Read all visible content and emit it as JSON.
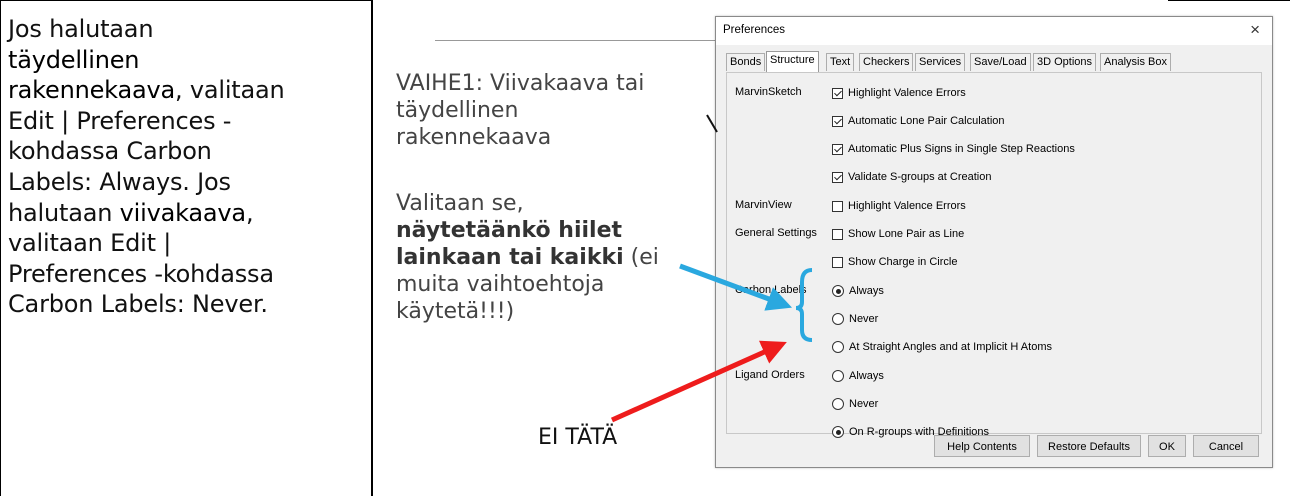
{
  "left_text": {
    "l1": "Jos halutaan",
    "l2": "täydellinen",
    "l3a": "rakennekaava",
    "l3b": ", valitaan",
    "l4": "Edit | Preferences -",
    "l5": "kohdassa Carbon",
    "l6": "Labels:  Always. Jos",
    "l7a": "halutaan ",
    "l7b": "viivakaava",
    "l7c": ",",
    "l8": "valitaan Edit |",
    "l9": "Preferences -kohdassa",
    "l10": "Carbon Labels: Never."
  },
  "middle": {
    "step_l1": "VAIHE1: Viivakaava tai",
    "step_l2": "täydellinen",
    "step_l3": "rakennekaava",
    "choose_l1": "Valitaan se,",
    "choose_b1": "näytetäänkö hiilet",
    "choose_b2": "lainkaan tai kaikki",
    "choose_l3b": " (ei",
    "choose_l4": "muita vaihtoehtoja",
    "choose_l5": "käytetä!!!)",
    "not_this": "EI TÄTÄ"
  },
  "dialog": {
    "title": "Preferences",
    "close": "×",
    "tabs": [
      "Bonds",
      "Structure",
      "Text",
      "Checkers",
      "Services",
      "Save/Load",
      "3D Options",
      "Analysis Box"
    ],
    "active_tab": "Structure",
    "sections": {
      "marvinsketch": "MarvinSketch",
      "marvinview": "MarvinView",
      "general": "General Settings",
      "carbon": "Carbon Labels",
      "ligand": "Ligand Orders"
    },
    "options": {
      "highlight_valence_sketch": "Highlight Valence Errors",
      "auto_lone_pair": "Automatic Lone Pair Calculation",
      "auto_plus_signs": "Automatic Plus Signs in Single Step Reactions",
      "validate_sgroups": "Validate S-groups at Creation",
      "highlight_valence_view": "Highlight Valence Errors",
      "lone_pair_line": "Show Lone Pair as Line",
      "charge_circle": "Show Charge in Circle",
      "carbon_always": "Always",
      "carbon_never": "Never",
      "carbon_straight": "At Straight Angles and at Implicit H Atoms",
      "ligand_always": "Always",
      "ligand_never": "Never",
      "ligand_rgroups": "On R-groups with Definitions"
    },
    "buttons": {
      "help": "Help Contents",
      "restore": "Restore Defaults",
      "ok": "OK",
      "cancel": "Cancel"
    }
  },
  "colors": {
    "blue_arrow": "#2aa8df",
    "red_arrow": "#ee1c1c"
  }
}
